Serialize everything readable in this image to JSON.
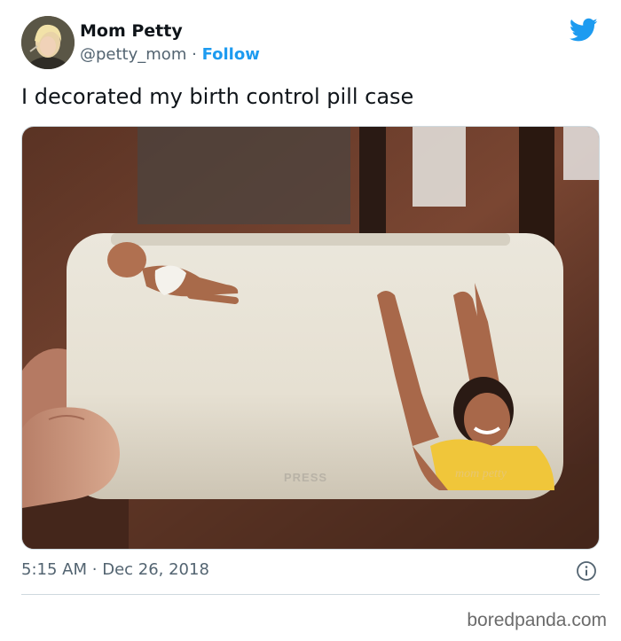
{
  "author": {
    "name": "Mom Petty",
    "handle": "@petty_mom",
    "separator": "·",
    "follow_label": "Follow"
  },
  "tweet": {
    "text": "I decorated my birth control pill case",
    "time": "5:15 AM",
    "date_separator": "·",
    "date": "Dec 26, 2018"
  },
  "photo": {
    "case_label": "PRESS",
    "signature": "mom petty"
  },
  "icons": {
    "brand": "twitter-bird-icon",
    "info": "info-icon"
  },
  "colors": {
    "accent": "#1d9bf0",
    "text": "#0f1419",
    "muted": "#536471"
  },
  "watermark": "boredpanda.com"
}
